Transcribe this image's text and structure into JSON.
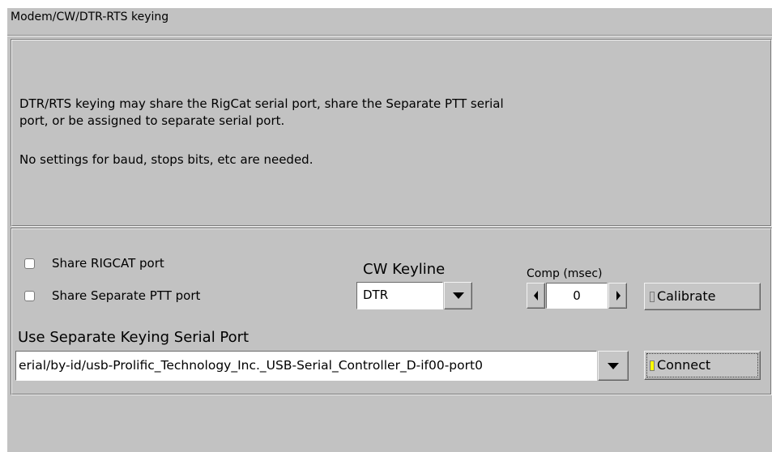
{
  "window": {
    "title": "Modem/CW/DTR-RTS keying"
  },
  "info": {
    "line1": "DTR/RTS keying may share the RigCat serial port, share the Separate PTT serial",
    "line2": "port, or be assigned to separate serial port.",
    "line3": "No settings for baud, stops bits, etc are needed."
  },
  "options": {
    "share_rigcat_label": "Share RIGCAT port",
    "share_rigcat_checked": false,
    "share_ptt_label": "Share Separate PTT port",
    "share_ptt_checked": false
  },
  "cw_keyline": {
    "label": "CW Keyline",
    "value": "DTR"
  },
  "comp": {
    "label": "Comp (msec)",
    "value": "0"
  },
  "calibrate": {
    "label": "Calibrate"
  },
  "serial_port": {
    "label": "Use Separate Keying Serial Port",
    "value": "erial/by-id/usb-Prolific_Technology_Inc._USB-Serial_Controller_D-if00-port0"
  },
  "connect": {
    "label": "Connect",
    "indicator_color": "#ffff00"
  },
  "colors": {
    "background": "#c2c2c2",
    "field": "#ffffff"
  }
}
